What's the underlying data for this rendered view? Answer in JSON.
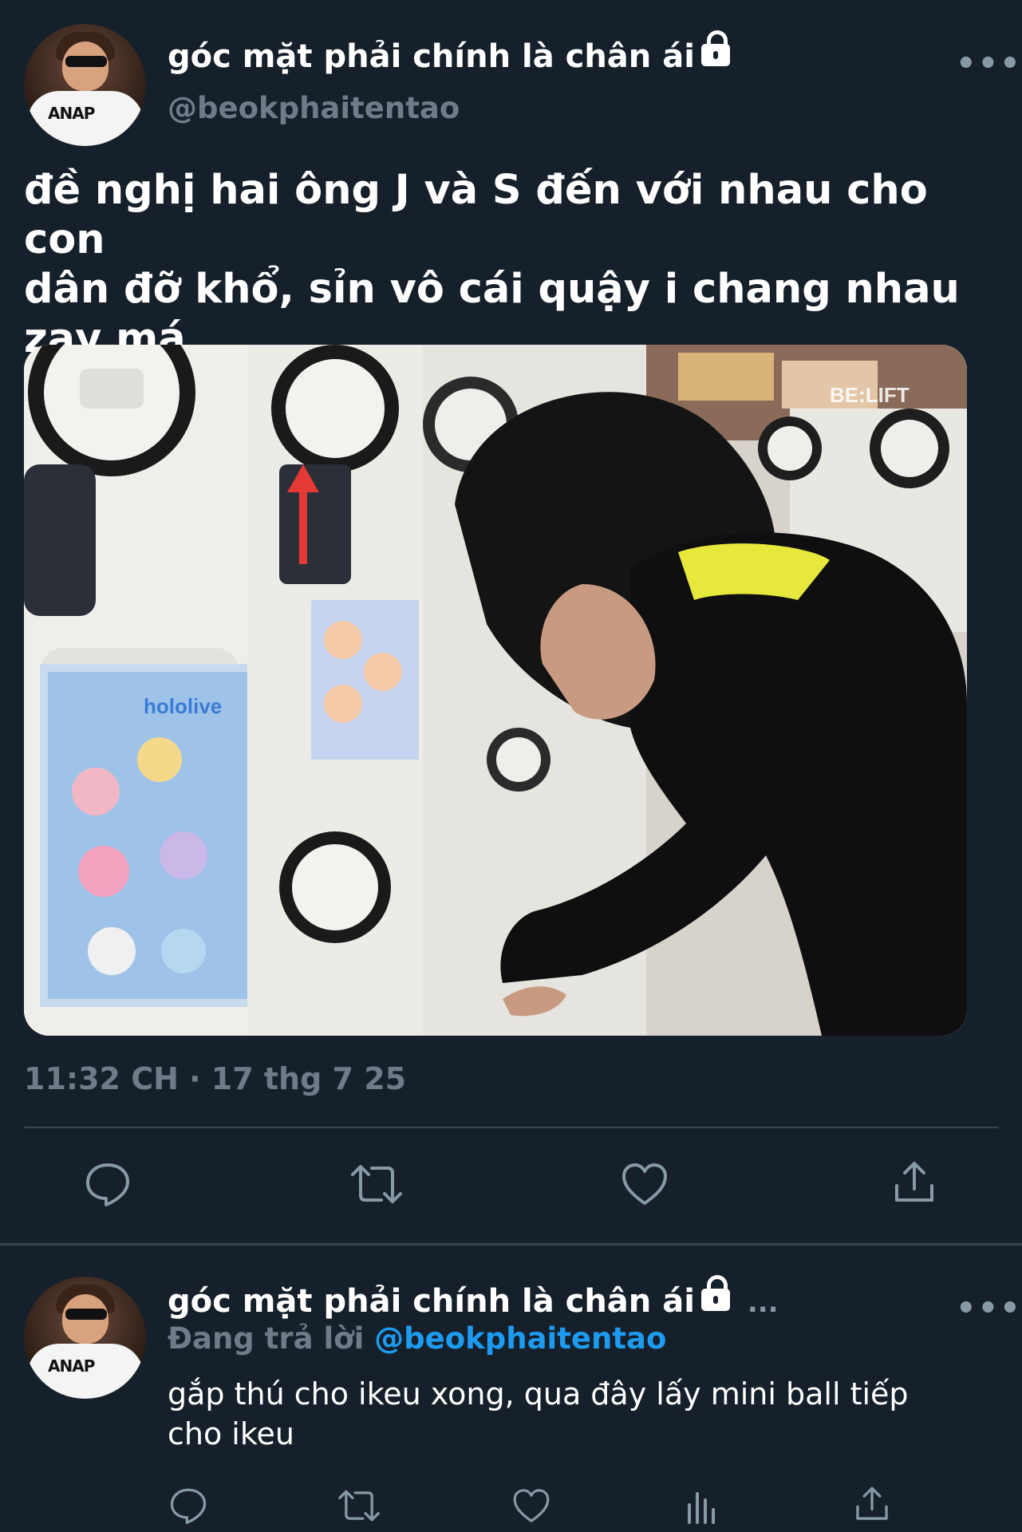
{
  "tweet": {
    "author_name": "góc mặt phải chính là chân ái",
    "author_handle": "@beokphaitentao",
    "text_line1": "đề nghị hai ông J và S đến với nhau cho con",
    "text_line2": "dân đỡ khổ, sỉn vô cái quậy i chang nhau",
    "text_line3": "zạy má",
    "media_watermark": "BE:LIFT",
    "timestamp": "11:32 CH · 17 thg 7 25",
    "more_label": "•••"
  },
  "actions": [
    "reply-icon",
    "retweet-icon",
    "like-icon",
    "share-icon"
  ],
  "reply": {
    "author_name": "góc mặt phải chính là chân ái",
    "more_label": "•••",
    "ellipsis": "...",
    "replying_prefix": "Đang trả lời",
    "replying_handle": "@beokphaitentao",
    "text_line1": "gắp thú cho ikeu xong, qua đây lấy mini ball tiếp",
    "text_line2": "cho ikeu"
  },
  "reply_actions": [
    "reply-icon",
    "retweet-icon",
    "like-icon",
    "analytics-icon",
    "share-icon"
  ],
  "colors": {
    "background": "#15202b",
    "text": "#ffffff",
    "secondary": "#6e7b88",
    "link": "#1d9bf0",
    "divider": "#38444d"
  }
}
